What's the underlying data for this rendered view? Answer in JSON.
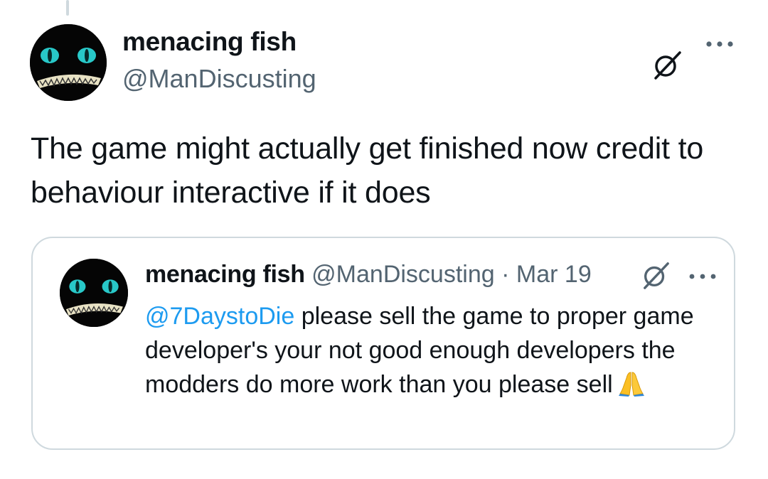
{
  "tweet": {
    "author": {
      "name": "menacing fish",
      "handle": "@ManDiscusting",
      "avatar_icon": "grinning-cat-avatar-icon"
    },
    "text": "The game might actually get finished now credit to behaviour interactive if it does",
    "actions": {
      "grok_icon": "grok-icon",
      "more_icon": "more-options-icon"
    }
  },
  "quoted_tweet": {
    "author": {
      "name": "menacing fish",
      "handle": "@ManDiscusting",
      "avatar_icon": "grinning-cat-avatar-icon"
    },
    "separator": "·",
    "date": "Mar 19",
    "mention": "@7DaystoDie",
    "text": " please sell the game to proper game developer's your not good enough developers the modders do more work than you please sell",
    "emoji": "folded-hands-emoji"
  },
  "colors": {
    "text_primary": "#0f1419",
    "text_secondary": "#536471",
    "link": "#1d9bf0",
    "border": "#cfd9de",
    "avatar_eyes": "#28c8c8"
  }
}
